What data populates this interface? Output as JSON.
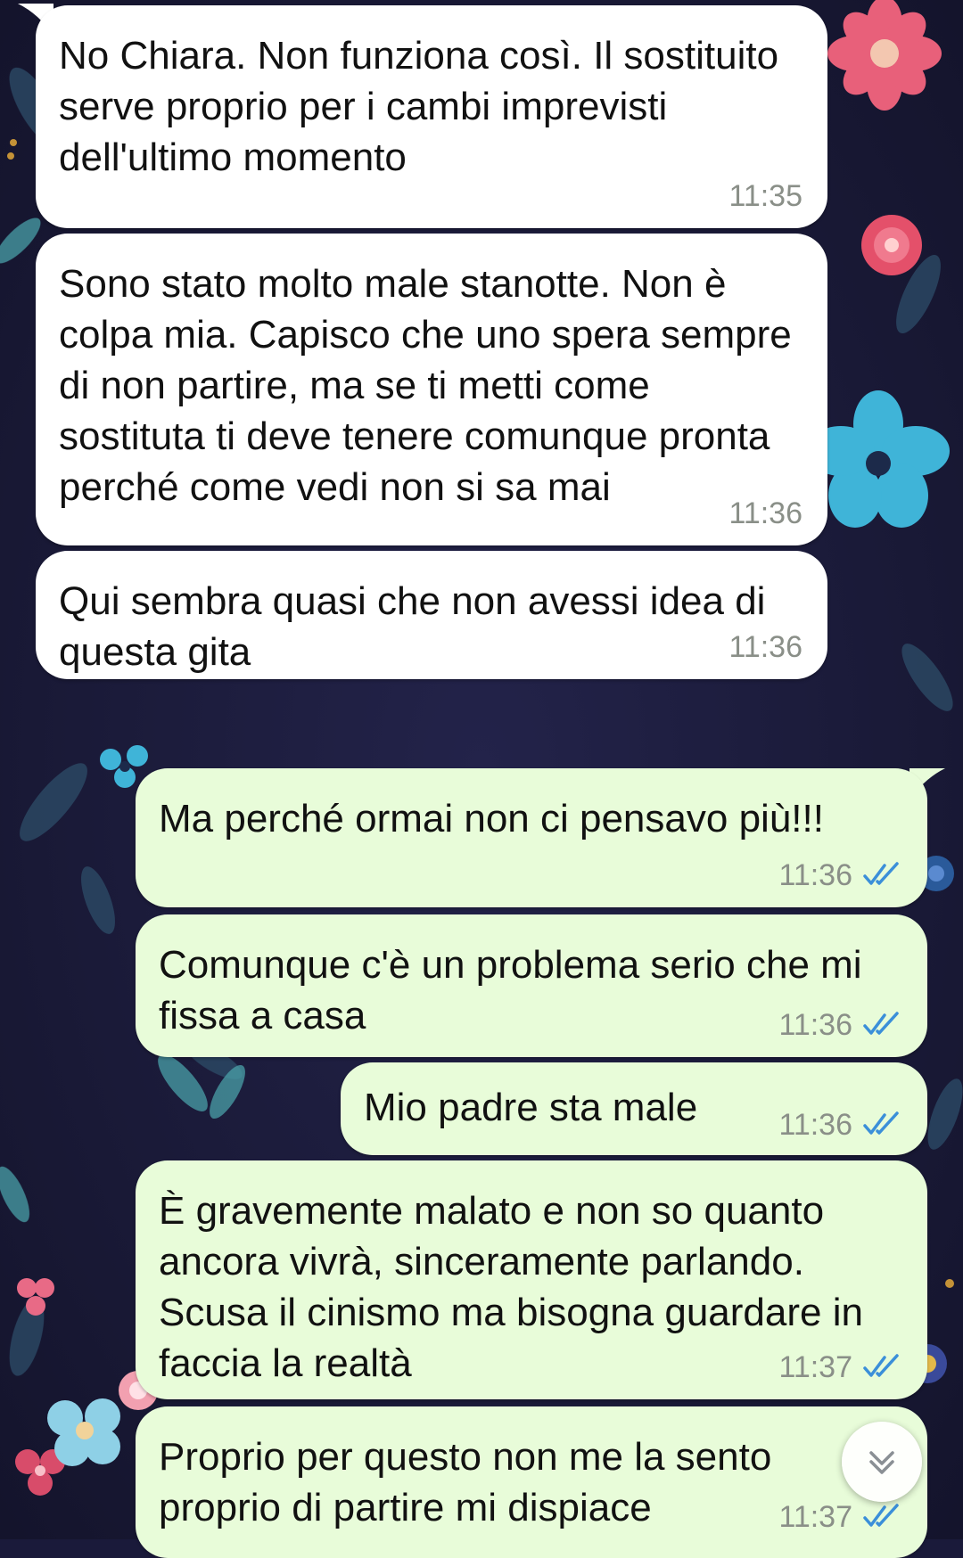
{
  "colors": {
    "wallpaper_bg": "#1a1a3a",
    "incoming_bubble": "#ffffff",
    "outgoing_bubble": "#e8fcd9",
    "timestamp": "#8a8f88",
    "read_ticks": "#3b8fd9"
  },
  "messages": [
    {
      "direction": "incoming",
      "text": "No Chiara. Non funziona così. Il sostituito serve proprio per i cambi imprevisti dell'ultimo momento",
      "time": "11:35"
    },
    {
      "direction": "incoming",
      "text": "Sono stato molto male stanotte. Non è colpa mia. Capisco che uno spera sempre di non partire, ma se ti metti come sostituta ti deve tenere comunque pronta perché come vedi non si sa mai",
      "time": "11:36"
    },
    {
      "direction": "incoming",
      "text": "Qui sembra quasi che non avessi idea di questa gita",
      "time": "11:36"
    },
    {
      "direction": "outgoing",
      "text": "Ma perché ormai non ci pensavo più!!!",
      "time": "11:36",
      "status_icon": "double-check-read-icon"
    },
    {
      "direction": "outgoing",
      "text": "Comunque c'è un problema serio che mi fissa a casa",
      "time": "11:36",
      "status_icon": "double-check-read-icon"
    },
    {
      "direction": "outgoing",
      "text": "Mio padre sta male",
      "time": "11:36",
      "status_icon": "double-check-read-icon"
    },
    {
      "direction": "outgoing",
      "text": "È gravemente malato e non so quanto ancora vivrà, sinceramente parlando. Scusa il cinismo ma bisogna guardare in faccia la realtà",
      "time": "11:37",
      "status_icon": "double-check-read-icon"
    },
    {
      "direction": "outgoing",
      "text": "Proprio per questo non me la sento proprio di partire mi dispiace",
      "time": "11:37",
      "status_icon": "double-check-read-icon"
    }
  ],
  "scroll_button": {
    "icon": "chevron-down-icon"
  }
}
